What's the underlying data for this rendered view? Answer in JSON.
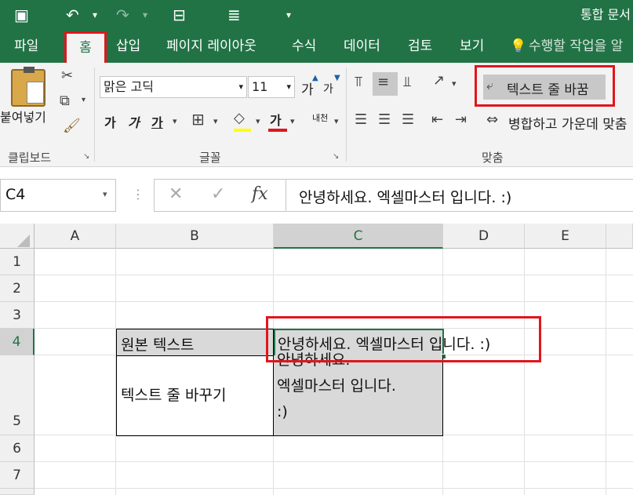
{
  "titlebar": {
    "doc_title": "통합 문서"
  },
  "tabs": [
    {
      "label": "파일"
    },
    {
      "label": "홈"
    },
    {
      "label": "삽입"
    },
    {
      "label": "페이지 레이아웃"
    },
    {
      "label": "수식"
    },
    {
      "label": "데이터"
    },
    {
      "label": "검토"
    },
    {
      "label": "보기"
    }
  ],
  "tell_me": "수행할 작업을 알",
  "ribbon": {
    "paste_label": "붙여넣기",
    "clipboard_group": "클립보드",
    "font_name": "맑은 고딕",
    "font_size": "11",
    "font_grow": "가",
    "font_shrink": "가",
    "bold": "가",
    "italic": "가",
    "underline": "가",
    "font_color_glyph": "가",
    "phonetic": "내천",
    "font_group": "글꼴",
    "wrap_text": "텍스트 줄 바꿈",
    "merge_center": "병합하고 가운데 맞춤",
    "align_group": "맞춤"
  },
  "formula_bar": {
    "name_box": "C4",
    "formula": "안녕하세요. 엑셀마스터 입니다. :)"
  },
  "columns": [
    "A",
    "B",
    "C",
    "D",
    "E"
  ],
  "rows": [
    "1",
    "2",
    "3",
    "4",
    "5",
    "6",
    "7"
  ],
  "cells": {
    "B4": "원본 텍스트",
    "C4": "안녕하세요. 엑셀마스터 입니다. :)",
    "B5": "텍스트 줄 바꾸기",
    "C5_lines": [
      "안녕하세요.",
      "엑셀마스터 입니다.",
      ":)"
    ]
  },
  "colors": {
    "excel_green": "#217346",
    "highlight_red": "#e0161d",
    "selection_gray": "#d9d9d9"
  }
}
